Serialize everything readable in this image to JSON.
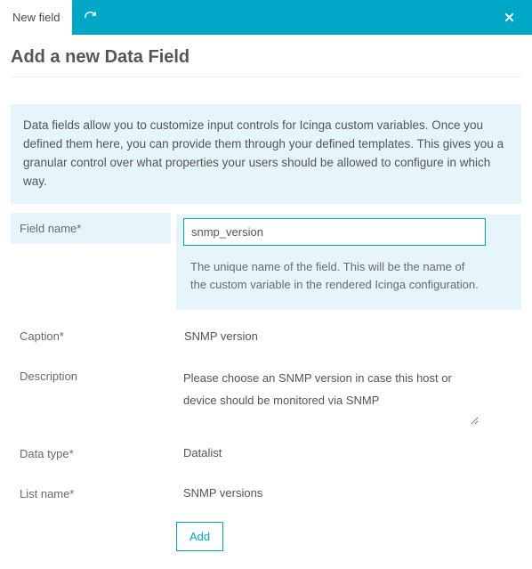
{
  "header": {
    "tab_label": "New field"
  },
  "page": {
    "title": "Add a new Data Field",
    "info": "Data fields allow you to customize input controls for Icinga custom variables. Once you defined them here, you can provide them through your defined templates. This gives you a granular control over what properties your users should be allowed to configure in which way."
  },
  "form": {
    "field_name": {
      "label": "Field name*",
      "value": "snmp_version",
      "help": "The unique name of the field. This will be the name of the custom variable in the rendered Icinga configuration."
    },
    "caption": {
      "label": "Caption*",
      "value": "SNMP version"
    },
    "description": {
      "label": "Description",
      "value": "Please choose an SNMP version in case this host or device should be monitored via SNMP"
    },
    "data_type": {
      "label": "Data type*",
      "value": "Datalist"
    },
    "list_name": {
      "label": "List name*",
      "value": "SNMP versions"
    },
    "submit_label": "Add"
  }
}
